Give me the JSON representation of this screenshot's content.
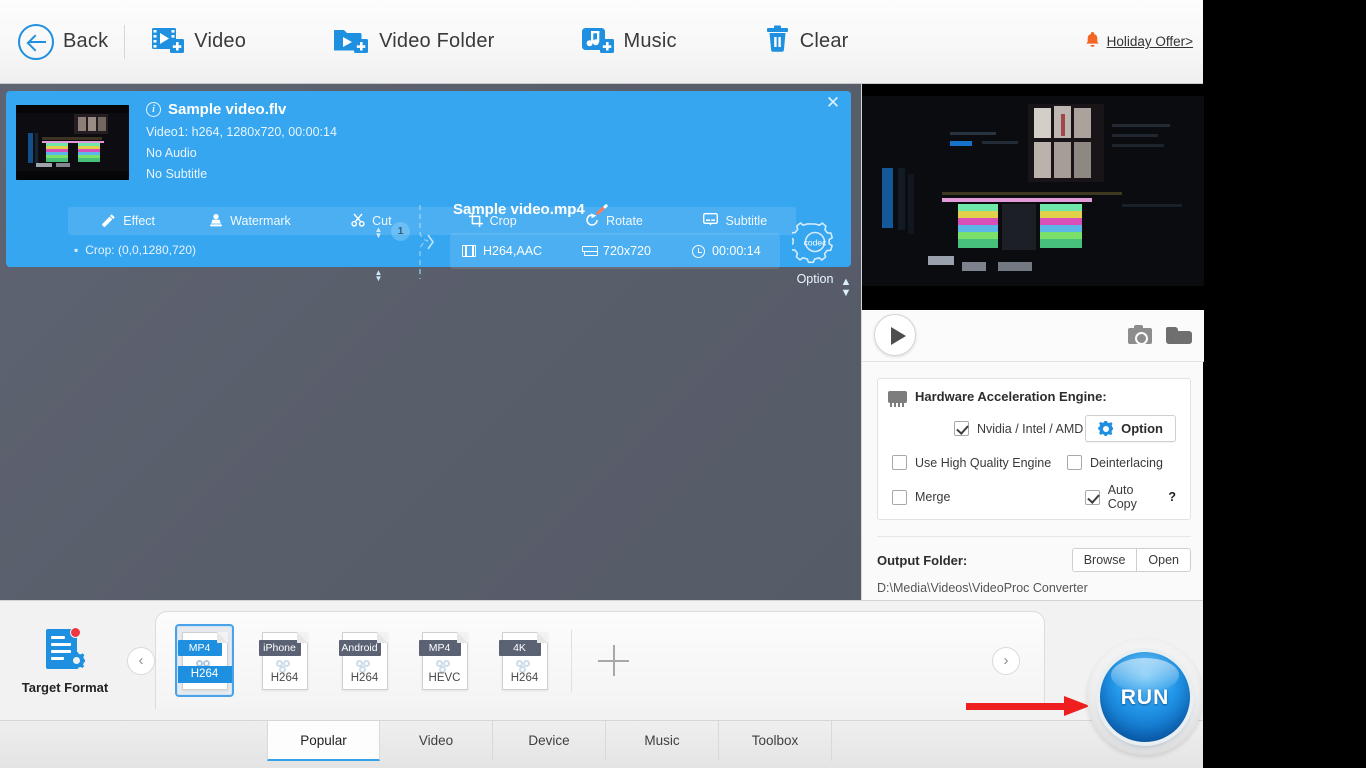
{
  "toolbar": {
    "items": [
      {
        "id": "back",
        "label": "Back",
        "icon": "back-arrow-icon"
      },
      {
        "id": "video",
        "label": "Video",
        "icon": "add-video-icon"
      },
      {
        "id": "video-folder",
        "label": "Video Folder",
        "icon": "add-video-folder-icon"
      },
      {
        "id": "music",
        "label": "Music",
        "icon": "add-music-icon"
      },
      {
        "id": "clear",
        "label": "Clear",
        "icon": "trash-icon"
      }
    ],
    "promo": {
      "label": "Holiday Offer>",
      "icon": "bell-icon",
      "color": "#f26522"
    }
  },
  "file_card": {
    "close_label": "✕",
    "source": {
      "name": "Sample video.flv",
      "video_line": "Video1: h264, 1280x720, 00:00:14",
      "audio_line": "No Audio",
      "subtitle_line": "No Subtitle",
      "track_badge": "1"
    },
    "output": {
      "name": "Sample video.mp4",
      "codec": "H264,AAC",
      "resolution": "720x720",
      "duration": "00:00:14",
      "option_label": "Option",
      "option_badge": "codec"
    },
    "edit_tabs": [
      {
        "label": "Effect",
        "icon": "magic-wand-icon"
      },
      {
        "label": "Watermark",
        "icon": "stamp-icon"
      },
      {
        "label": "Cut",
        "icon": "scissors-icon"
      },
      {
        "label": "Crop",
        "icon": "crop-icon"
      },
      {
        "label": "Rotate",
        "icon": "rotate-icon"
      },
      {
        "label": "Subtitle",
        "icon": "subtitle-icon"
      }
    ],
    "note": "Crop: (0,0,1280,720)"
  },
  "right_panel": {
    "player": {
      "play_label": "play-button",
      "snapshot_icon": "camera-icon",
      "folder_icon": "folder-icon"
    },
    "hardware": {
      "title": "Hardware Acceleration Engine:",
      "gpu_option": {
        "label": "Nvidia / Intel / AMD",
        "checked": true
      },
      "option_button": "Option",
      "checkboxes": [
        {
          "label": "Use High Quality Engine",
          "checked": false
        },
        {
          "label": "Deinterlacing",
          "checked": false
        },
        {
          "label": "Merge",
          "checked": false
        },
        {
          "label": "Auto Copy",
          "checked": true,
          "suffix": "?"
        }
      ]
    },
    "output_folder": {
      "label": "Output Folder:",
      "browse": "Browse",
      "open": "Open",
      "path": "D:\\Media\\Videos\\VideoProc Converter"
    }
  },
  "bottom": {
    "target_format_label": "Target Format",
    "prev_label": "‹",
    "next_label": "›",
    "formats": [
      {
        "tag": "MP4",
        "codec": "H264",
        "selected": true
      },
      {
        "tag": "iPhone",
        "codec": "H264",
        "selected": false
      },
      {
        "tag": "Android",
        "codec": "H264",
        "selected": false
      },
      {
        "tag": "MP4",
        "codec": "HEVC",
        "selected": false
      },
      {
        "tag": "4K",
        "codec": "H264",
        "selected": false
      }
    ],
    "add_label": "add-format-icon",
    "category_tabs": [
      {
        "label": "Popular",
        "active": true
      },
      {
        "label": "Video",
        "active": false
      },
      {
        "label": "Device",
        "active": false
      },
      {
        "label": "Music",
        "active": false
      },
      {
        "label": "Toolbox",
        "active": false
      }
    ],
    "run_label": "RUN"
  },
  "colors": {
    "accent_blue": "#1f90e0",
    "card_blue": "#37a6f0",
    "workarea_gray": "#5c6170",
    "promo_orange": "#f26522",
    "arrow_red": "#ef1f1f"
  }
}
